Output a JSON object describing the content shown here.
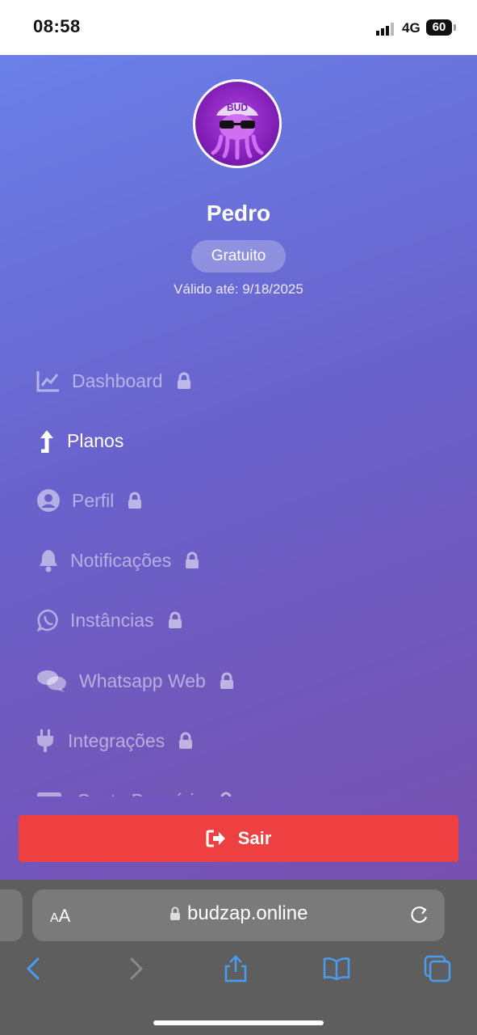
{
  "status_bar": {
    "time": "08:58",
    "network": "4G",
    "battery": "60"
  },
  "profile": {
    "name": "Pedro",
    "plan": "Gratuito",
    "valid_until": "Válido até: 9/18/2025"
  },
  "nav": {
    "items": [
      {
        "label": "Dashboard",
        "icon": "chart-line-icon",
        "locked": true
      },
      {
        "label": "Planos",
        "icon": "arrow-turn-up-icon",
        "locked": false,
        "active": true
      },
      {
        "label": "Perfil",
        "icon": "user-circle-icon",
        "locked": true
      },
      {
        "label": "Notificações",
        "icon": "bell-icon",
        "locked": true
      },
      {
        "label": "Instâncias",
        "icon": "whatsapp-icon",
        "locked": true
      },
      {
        "label": "Whatsapp Web",
        "icon": "comments-icon",
        "locked": true
      },
      {
        "label": "Integrações",
        "icon": "plug-icon",
        "locked": true
      },
      {
        "label": "Conta Bancária",
        "icon": "credit-card-icon",
        "locked": true
      }
    ]
  },
  "logout": {
    "label": "Sair"
  },
  "browser": {
    "text_size_label_small": "A",
    "text_size_label_large": "A",
    "url": "budzap.online"
  },
  "colors": {
    "accent_start": "#6a80e8",
    "accent_end": "#7650ad",
    "logout": "#ee4040"
  }
}
